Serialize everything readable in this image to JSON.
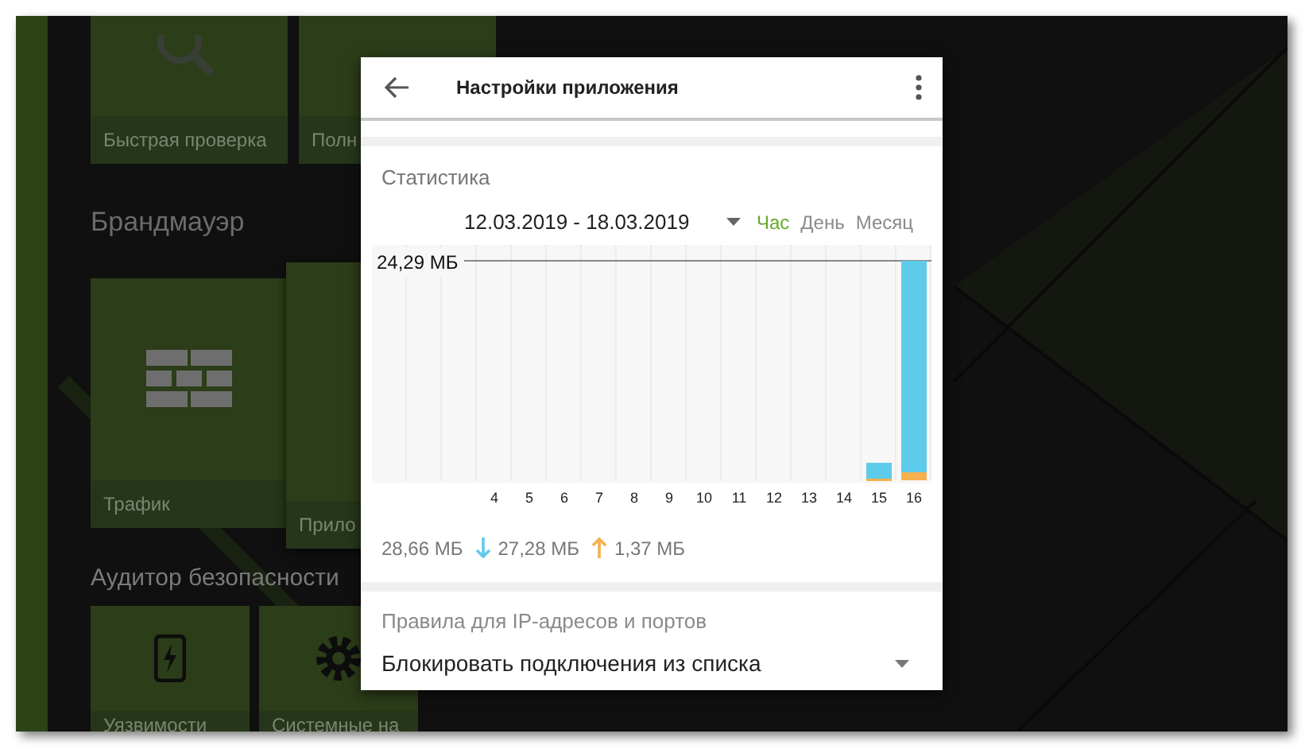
{
  "background": {
    "top_tiles": [
      {
        "label": "Быстрая проверка"
      },
      {
        "label": "Полн"
      }
    ],
    "firewall": {
      "heading": "Брандмауэр",
      "tiles": [
        {
          "label": "Трафик"
        },
        {
          "label": "Прило"
        }
      ]
    },
    "auditor": {
      "heading": "Аудитор безопасности",
      "tiles": [
        {
          "label": "Уязвимости"
        },
        {
          "label": "Системные на"
        }
      ]
    }
  },
  "dialog": {
    "title": "Настройки приложения",
    "statistics": {
      "heading": "Статистика",
      "date_range": "12.03.2019 - 18.03.2019",
      "periods": [
        {
          "label": "Час",
          "selected": true
        },
        {
          "label": "День",
          "selected": false
        },
        {
          "label": "Месяц",
          "selected": false
        }
      ],
      "max_label": "24,29 МБ",
      "x_labels": [
        "4",
        "5",
        "6",
        "7",
        "8",
        "9",
        "10",
        "11",
        "12",
        "13",
        "14",
        "15",
        "16"
      ],
      "total": "28,66 МБ",
      "download": "27,28 МБ",
      "upload": "1,37 МБ"
    },
    "rules": {
      "label": "Правила для IP-адресов и портов",
      "value": "Блокировать подключения из списка"
    }
  }
}
